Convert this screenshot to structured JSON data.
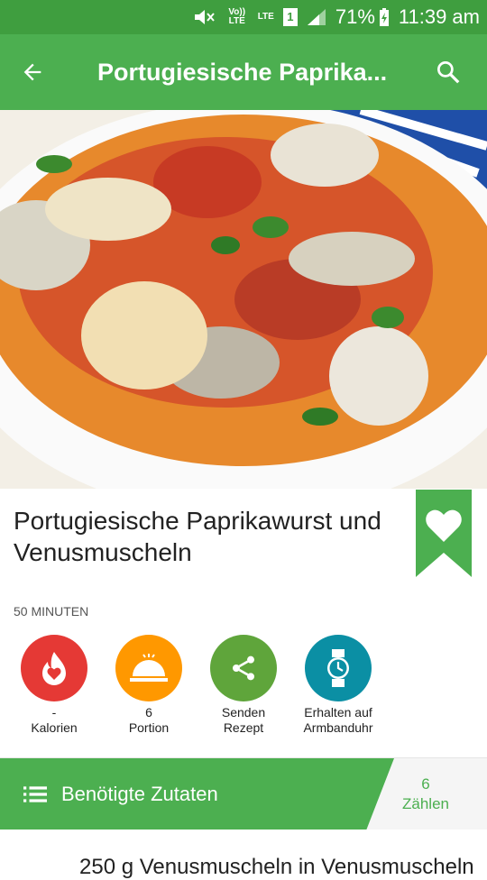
{
  "status_bar": {
    "battery": "71%",
    "time": "11:39 am",
    "volte": "Vo)) LTE",
    "lte": "LTE",
    "sim": "1"
  },
  "app_bar": {
    "title": "Portugiesische Paprika..."
  },
  "recipe": {
    "title": "Portugiesische Paprikawurst und Venusmuscheln",
    "duration": "50 MINUTEN"
  },
  "actions": [
    {
      "value": "-",
      "label": "Kalorien",
      "color": "#e53935",
      "icon": "calories-icon"
    },
    {
      "value": "6",
      "label": "Portion",
      "color": "#ff9800",
      "icon": "serving-dish-icon"
    },
    {
      "value": "Senden",
      "label": "Rezept",
      "color": "#5fa53b",
      "icon": "share-icon"
    },
    {
      "value": "Erhalten auf",
      "label": "Armbanduhr",
      "color": "#0b8fa4",
      "icon": "watch-icon"
    }
  ],
  "ingredients_bar": {
    "title": "Benötigte Zutaten",
    "count": "6",
    "count_label": "Zählen"
  },
  "bottom": {
    "partial_text": "250 g Venusmuscheln in Venusmuscheln"
  },
  "colors": {
    "primary": "#4caf50",
    "status_bar": "#3f9e3f"
  }
}
